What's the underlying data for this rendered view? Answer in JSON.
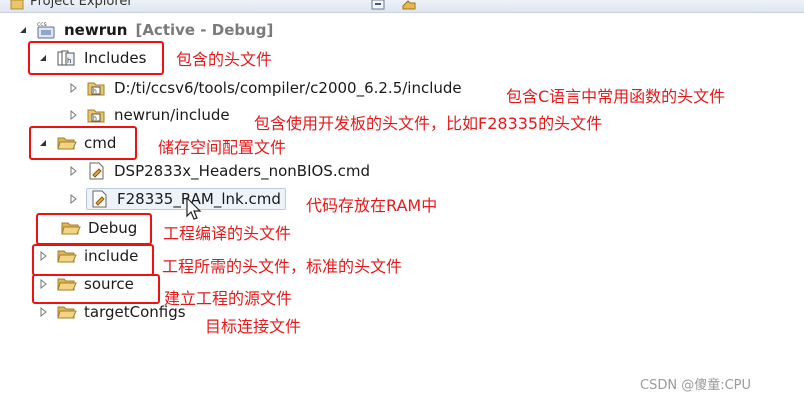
{
  "window": {
    "title": "Project Explorer"
  },
  "tree": {
    "project": {
      "name": "newrun",
      "status": "[Active - Debug]",
      "icon": "ccs-project-icon"
    },
    "includes": {
      "label": "Includes"
    },
    "inc_compiler": {
      "label": "D:/ti/ccsv6/tools/compiler/c2000_6.2.5/include"
    },
    "inc_newrun": {
      "label": "newrun/include"
    },
    "cmd": {
      "label": "cmd"
    },
    "cmd_headers": {
      "label": "DSP2833x_Headers_nonBIOS.cmd"
    },
    "cmd_ram": {
      "label": "F28335_RAM_lnk.cmd"
    },
    "debug": {
      "label": "Debug"
    },
    "include": {
      "label": "include"
    },
    "source": {
      "label": "source"
    },
    "targetconfigs": {
      "label": "targetConfigs"
    }
  },
  "annotations": {
    "includes": "包含的头文件",
    "inc_compiler": "包含C语言中常用函数的头文件",
    "inc_newrun": "包含使用开发板的头文件，比如F28335的头文件",
    "cmd": "储存空间配置文件",
    "cmd_ram": "代码存放在RAM中",
    "debug": "工程编译的头文件",
    "include": "工程所需的头文件，标准的头文件",
    "source": "建立工程的源文件",
    "targetconfigs": "目标连接文件"
  },
  "watermark": "CSDN @傻童:CPU",
  "colors": {
    "annotation": "#e41a1a",
    "highlight_box": "#ee1111",
    "folder": "#e8c66a"
  }
}
